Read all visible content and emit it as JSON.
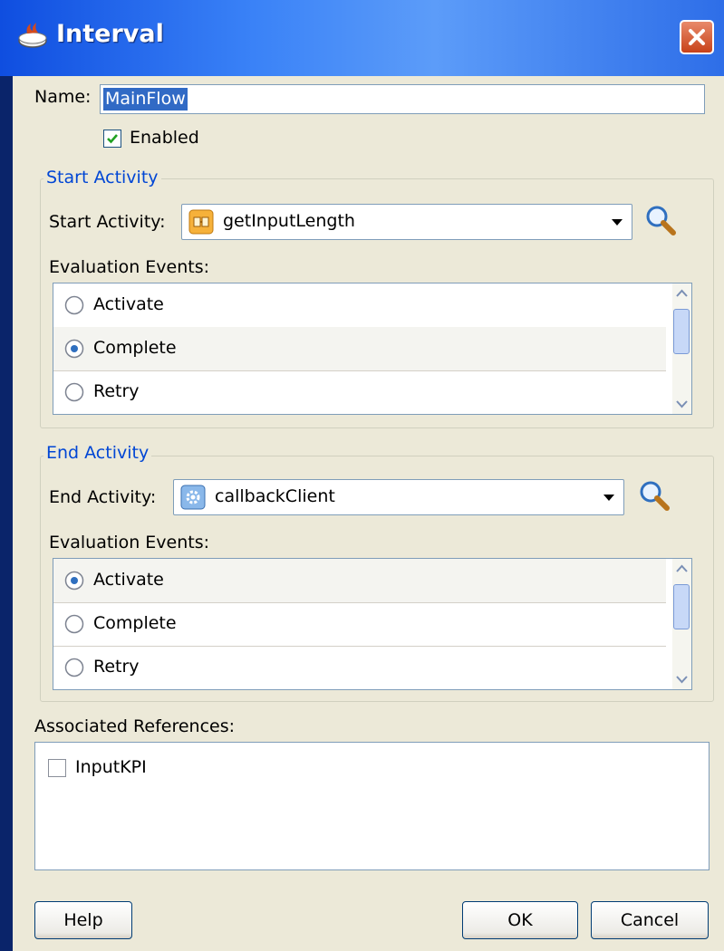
{
  "window": {
    "title": "Interval",
    "accent": "#0a246a"
  },
  "name": {
    "label": "Name:",
    "value": "MainFlow"
  },
  "enabled": {
    "label": "Enabled",
    "checked": true
  },
  "start": {
    "group_label": "Start Activity",
    "field_label": "Start Activity:",
    "value": "getInputLength",
    "icon": "activity-invoke-icon",
    "events_label": "Evaluation Events:",
    "events": [
      {
        "label": "Activate",
        "selected": false
      },
      {
        "label": "Complete",
        "selected": true
      },
      {
        "label": "Retry",
        "selected": false
      }
    ]
  },
  "end": {
    "group_label": "End Activity",
    "field_label": "End Activity:",
    "value": "callbackClient",
    "icon": "activity-gear-icon",
    "events_label": "Evaluation Events:",
    "events": [
      {
        "label": "Activate",
        "selected": true
      },
      {
        "label": "Complete",
        "selected": false
      },
      {
        "label": "Retry",
        "selected": false
      }
    ]
  },
  "references": {
    "label": "Associated References:",
    "items": [
      {
        "label": "InputKPI",
        "checked": false
      }
    ]
  },
  "buttons": {
    "help": "Help",
    "ok": "OK",
    "cancel": "Cancel"
  }
}
